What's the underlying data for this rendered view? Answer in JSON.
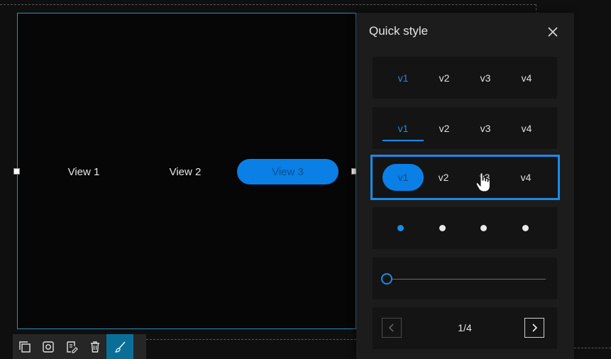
{
  "canvas": {
    "nav_items": [
      {
        "label": "View 1",
        "active": false
      },
      {
        "label": "View 2",
        "active": false
      },
      {
        "label": "View 3",
        "active": true
      }
    ]
  },
  "panel": {
    "title": "Quick style",
    "close_icon": "close-icon",
    "styles": [
      {
        "kind": "text-tabs",
        "options": [
          "v1",
          "v2",
          "v3",
          "v4"
        ],
        "active_index": 0
      },
      {
        "kind": "underline-tabs",
        "options": [
          "v1",
          "v2",
          "v3",
          "v4"
        ],
        "active_index": 0
      },
      {
        "kind": "pill-tabs",
        "options": [
          "v1",
          "v2",
          "v3",
          "v4"
        ],
        "active_index": 0,
        "selected": true
      },
      {
        "kind": "dots",
        "count": 4,
        "active_index": 0
      },
      {
        "kind": "slider",
        "value": 0
      },
      {
        "kind": "pagination",
        "label": "1/4",
        "prev_icon": "chevron-left-icon",
        "next_icon": "chevron-right-icon"
      }
    ]
  },
  "toolbar": {
    "buttons": [
      {
        "icon": "duplicate-icon",
        "active": false
      },
      {
        "icon": "settings-icon",
        "active": false
      },
      {
        "icon": "edit-icon",
        "active": false
      },
      {
        "icon": "delete-icon",
        "active": false
      },
      {
        "icon": "brush-icon",
        "active": true
      }
    ]
  },
  "colors": {
    "accent": "#1a8be8",
    "pill_fill": "#0a7fe6",
    "frame": "#2f8fc0",
    "panel_bg": "#1c1c1c",
    "card_bg": "#141414"
  }
}
